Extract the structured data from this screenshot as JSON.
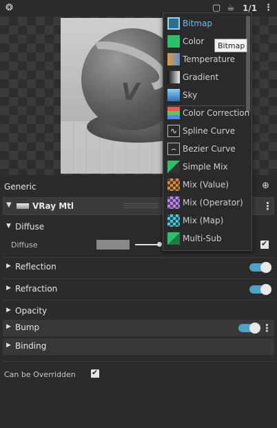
{
  "toolbar": {
    "viewport_icon": "ghost-icon",
    "square_icon": "square-icon",
    "teapot_icon": "teapot-icon",
    "ratio_label": "1/1",
    "menu_icon": "kebab-icon"
  },
  "panel": {
    "section_label": "Generic",
    "material_name": "VRay Mtl",
    "categories": {
      "diffuse": "Diffuse",
      "reflection": "Reflection",
      "refraction": "Refraction",
      "opacity": "Opacity",
      "bump": "Bump",
      "binding": "Binding"
    },
    "diffuse_param_label": "Diffuse",
    "diffuse_color": "#8a8a8a",
    "can_be_overridden_label": "Can be Overridden"
  },
  "menu": {
    "items": [
      {
        "label": "Bitmap",
        "icon": "bitmap-icon"
      },
      {
        "label": "Color",
        "icon": "color-icon"
      },
      {
        "label": "Temperature",
        "icon": "temperature-icon"
      },
      {
        "label": "Gradient",
        "icon": "gradient-icon"
      },
      {
        "label": "Sky",
        "icon": "sky-icon"
      },
      {
        "label": "Color Correction",
        "icon": "color-correction-icon"
      },
      {
        "label": "Spline Curve",
        "icon": "spline-curve-icon"
      },
      {
        "label": "Bezier Curve",
        "icon": "bezier-curve-icon"
      },
      {
        "label": "Simple Mix",
        "icon": "simple-mix-icon"
      },
      {
        "label": "Mix (Value)",
        "icon": "mix-value-icon"
      },
      {
        "label": "Mix (Operator)",
        "icon": "mix-operator-icon"
      },
      {
        "label": "Mix (Map)",
        "icon": "mix-map-icon"
      },
      {
        "label": "Multi-Sub",
        "icon": "multi-sub-icon"
      }
    ],
    "tooltip": "Bitmap"
  },
  "colors": {
    "accent": "#4ea3c4",
    "selected_text": "#6fc1ea"
  }
}
